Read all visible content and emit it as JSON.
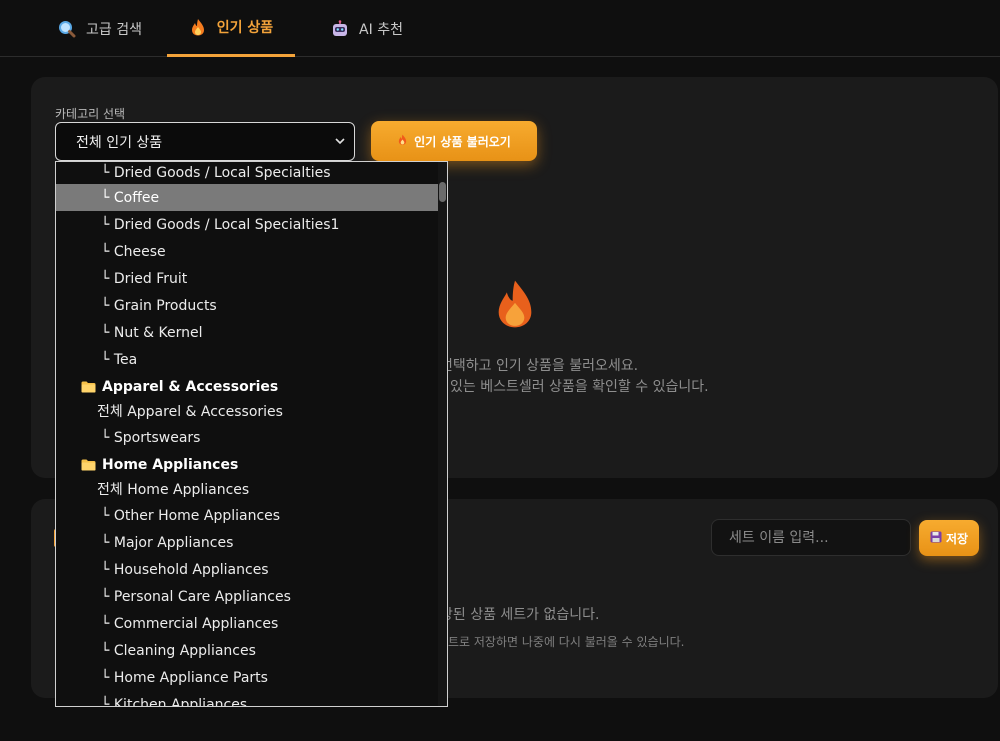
{
  "tabs": [
    {
      "label": "고급 검색",
      "icon": "magnifier-icon"
    },
    {
      "label": "인기 상품",
      "icon": "fire-icon"
    },
    {
      "label": "AI 추천",
      "icon": "robot-icon"
    }
  ],
  "popular": {
    "category_label": "카테고리 선택",
    "select_value": "전체 인기 상품",
    "load_button": "인기 상품 불러오기",
    "empty_line1": "선택하고 인기 상품을 불러오세요.",
    "empty_line2": "있는 베스트셀러 상품을 확인할 수 있습니다."
  },
  "sets": {
    "input_placeholder": "세트 이름 입력...",
    "save_button": "저장",
    "empty_line1": "장된 상품 세트가 없습니다.",
    "empty_line2": "트로 저장하면 나중에 다시 불러올 수 있습니다."
  },
  "dropdown": {
    "options": [
      {
        "text": "└ Dried Goods / Local Specialties",
        "type": "sub"
      },
      {
        "text": "└ Coffee",
        "type": "sub",
        "selected": true
      },
      {
        "text": "└ Dried Goods / Local Specialties1",
        "type": "sub"
      },
      {
        "text": "└ Cheese",
        "type": "sub"
      },
      {
        "text": "└ Dried Fruit",
        "type": "sub"
      },
      {
        "text": "└ Grain Products",
        "type": "sub"
      },
      {
        "text": "└ Nut & Kernel",
        "type": "sub"
      },
      {
        "text": "└ Tea",
        "type": "sub"
      },
      {
        "text": "Apparel & Accessories",
        "type": "group"
      },
      {
        "text": "전체 Apparel & Accessories",
        "type": "all"
      },
      {
        "text": "└ Sportswears",
        "type": "sub"
      },
      {
        "text": "Home Appliances",
        "type": "group"
      },
      {
        "text": "전체 Home Appliances",
        "type": "all"
      },
      {
        "text": "└ Other Home Appliances",
        "type": "sub"
      },
      {
        "text": "└ Major Appliances",
        "type": "sub"
      },
      {
        "text": "└ Household Appliances",
        "type": "sub"
      },
      {
        "text": "└ Personal Care Appliances",
        "type": "sub"
      },
      {
        "text": "└ Commercial Appliances",
        "type": "sub"
      },
      {
        "text": "└ Cleaning Appliances",
        "type": "sub"
      },
      {
        "text": "└ Home Appliance Parts",
        "type": "sub"
      },
      {
        "text": "└ Kitchen Appliances",
        "type": "sub"
      }
    ]
  },
  "colors": {
    "accent": "#f3a33a",
    "background": "#0f0f0f",
    "card": "#1b1b1b",
    "selected_option": "#7a7a7a"
  }
}
